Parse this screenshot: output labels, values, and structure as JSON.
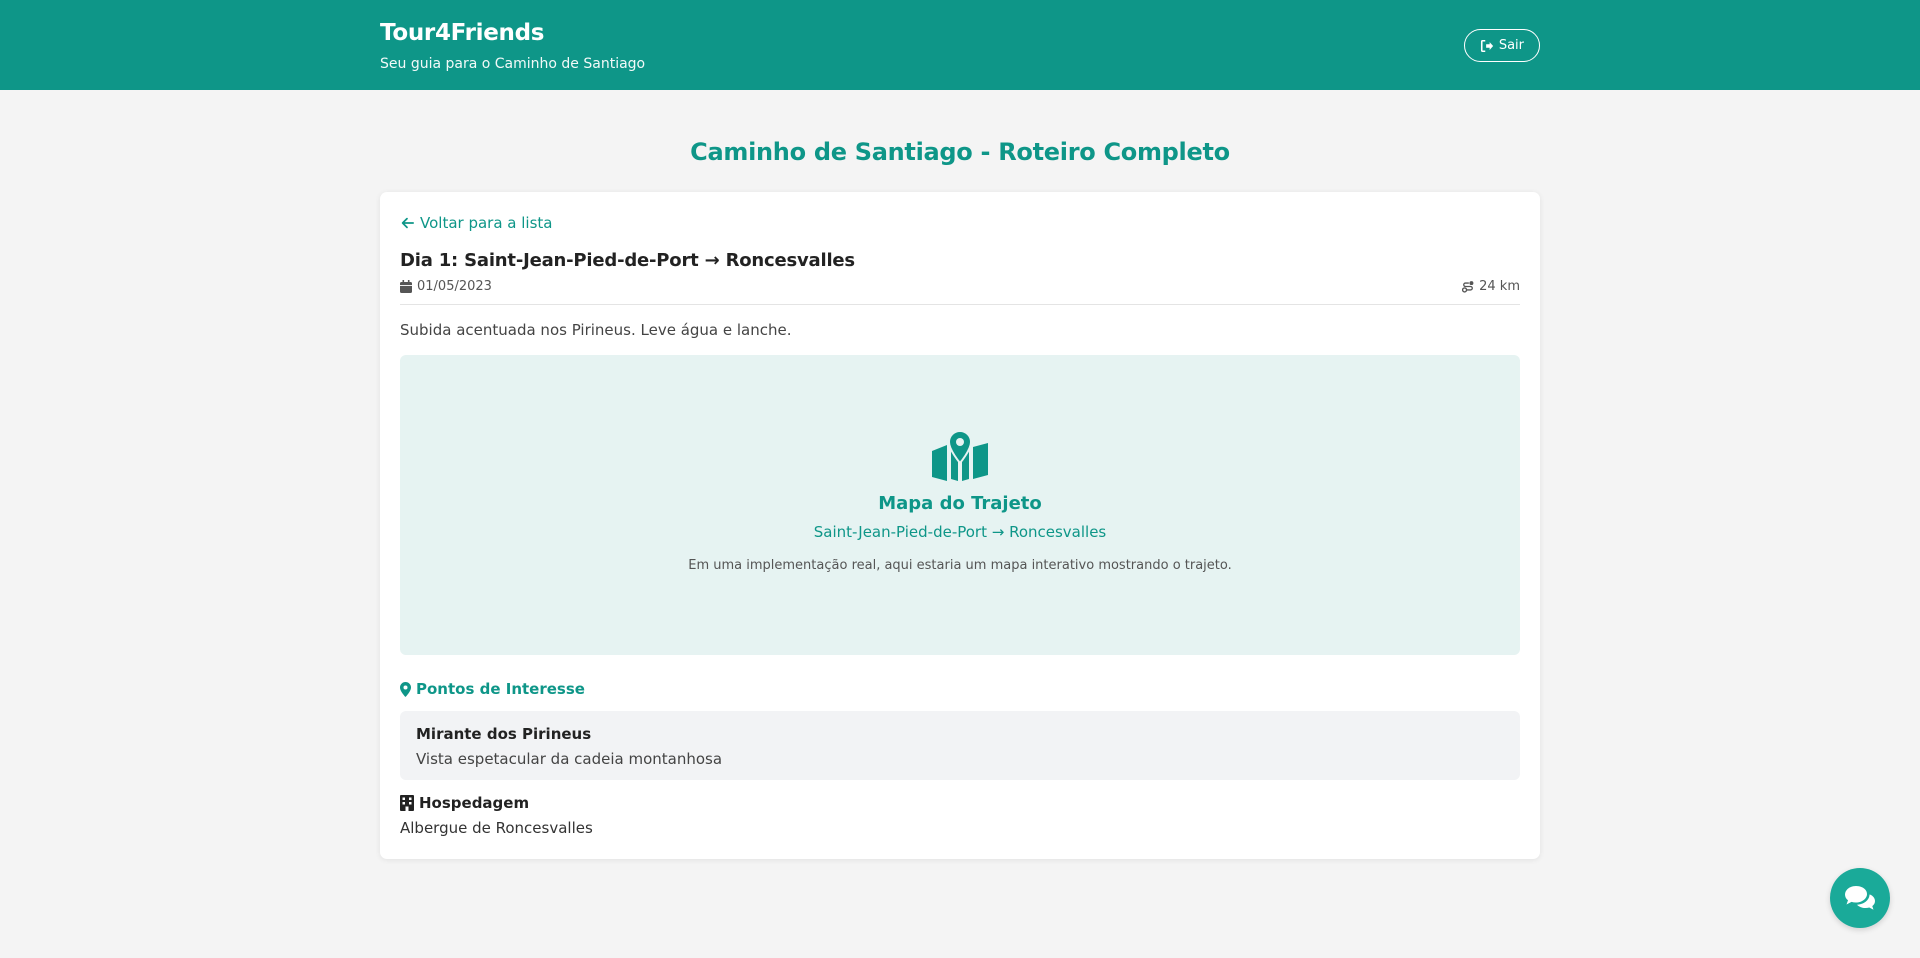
{
  "header": {
    "brand": "Tour4Friends",
    "tagline": "Seu guia para o Caminho de Santiago",
    "logout_label": "Sair"
  },
  "page_title": "Caminho de Santiago - Roteiro Completo",
  "detail": {
    "back_label": "Voltar para a lista",
    "day_title": "Dia 1: Saint-Jean-Pied-de-Port → Roncesvalles",
    "date": "01/05/2023",
    "distance": "24 km",
    "description": "Subida acentuada nos Pirineus. Leve água e lanche."
  },
  "map": {
    "title": "Mapa do Trajeto",
    "route": "Saint-Jean-Pied-de-Port → Roncesvalles",
    "note": "Em uma implementação real, aqui estaria um mapa interativo mostrando o trajeto."
  },
  "poi_section": {
    "heading": "Pontos de Interesse",
    "items": [
      {
        "name": "Mirante dos Pirineus",
        "description": "Vista espetacular da cadeia montanhosa"
      }
    ]
  },
  "lodging": {
    "heading": "Hospedagem",
    "name": "Albergue de Roncesvalles"
  },
  "icons": {
    "logout": "sign-out-icon",
    "back": "arrow-left-icon",
    "date": "calendar-icon",
    "distance": "route-icon",
    "map": "map-location-icon",
    "poi": "map-pin-icon",
    "lodging": "hotel-icon",
    "chat": "comments-icon"
  },
  "colors": {
    "brand": "#0e9688",
    "map_bg": "#e6f3f2",
    "chat_button": "#1aaa99",
    "page_bg": "#f4f4f4"
  }
}
